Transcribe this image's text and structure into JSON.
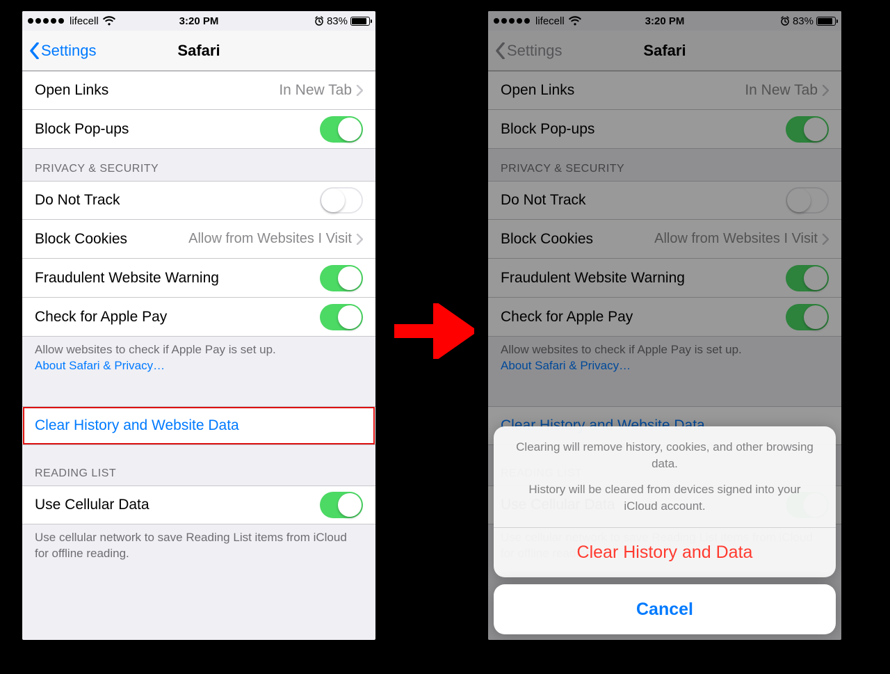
{
  "status": {
    "carrier": "lifecell",
    "time": "3:20 PM",
    "battery_pct": "83%"
  },
  "nav": {
    "back": "Settings",
    "title": "Safari"
  },
  "general": {
    "open_links": {
      "label": "Open Links",
      "value": "In New Tab"
    },
    "block_popups": {
      "label": "Block Pop-ups",
      "on": true
    }
  },
  "privacy": {
    "header": "PRIVACY & SECURITY",
    "do_not_track": {
      "label": "Do Not Track",
      "on": false
    },
    "block_cookies": {
      "label": "Block Cookies",
      "value": "Allow from Websites I Visit"
    },
    "fraud_warning": {
      "label": "Fraudulent Website Warning",
      "on": true
    },
    "apple_pay": {
      "label": "Check for Apple Pay",
      "on": true
    },
    "footer_text": "Allow websites to check if Apple Pay is set up.",
    "footer_link": "About Safari & Privacy…"
  },
  "clear": {
    "label": "Clear History and Website Data"
  },
  "reading": {
    "header": "READING LIST",
    "cellular": {
      "label": "Use Cellular Data",
      "on": true
    },
    "footer": "Use cellular network to save Reading List items from iCloud for offline reading."
  },
  "sheet": {
    "msg1": "Clearing will remove history, cookies, and other browsing data.",
    "msg2": "History will be cleared from devices signed into your iCloud account.",
    "destructive": "Clear History and Data",
    "cancel": "Cancel"
  }
}
